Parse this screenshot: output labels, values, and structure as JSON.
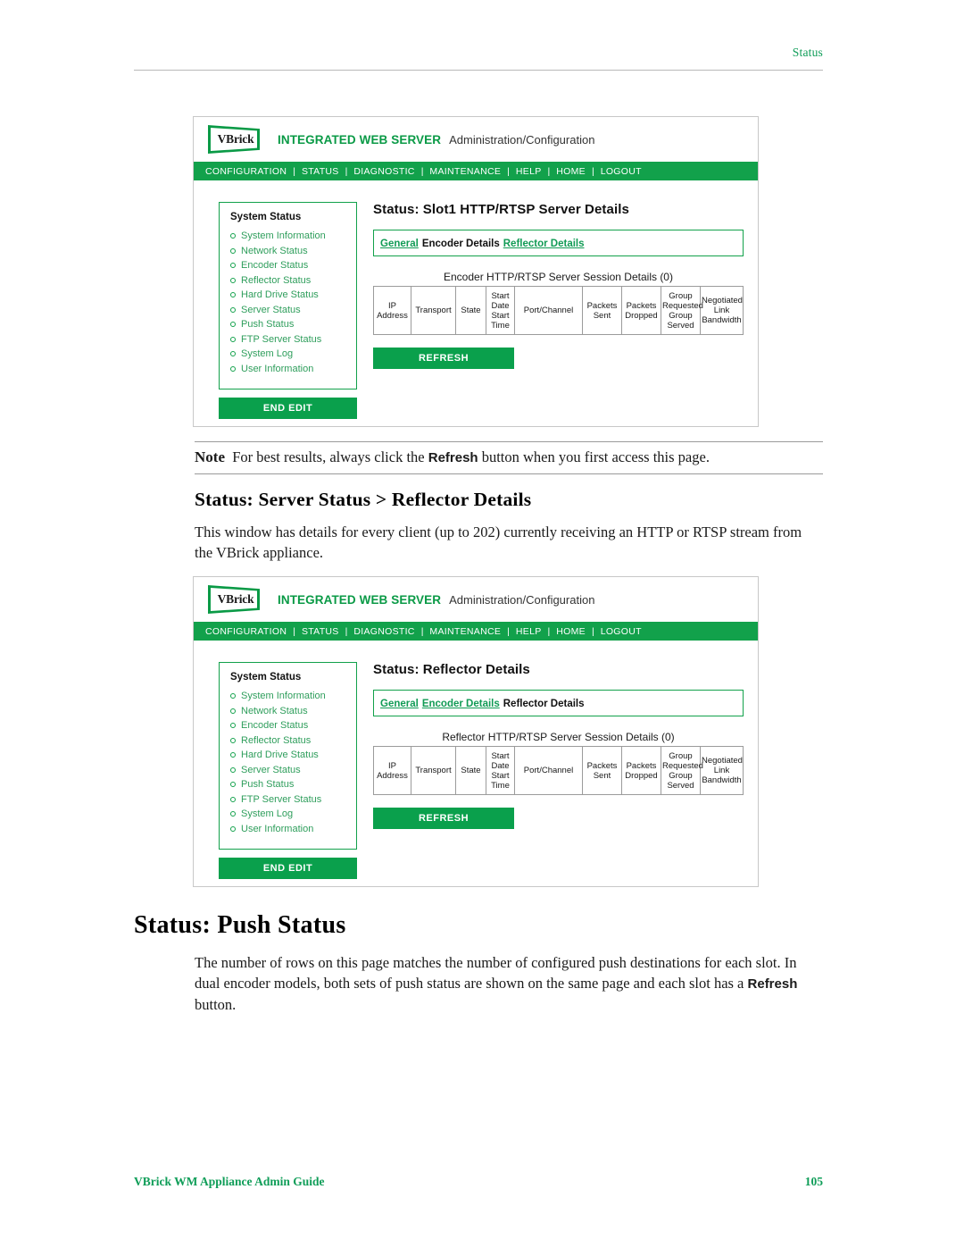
{
  "page": {
    "header_right": "Status",
    "footer_left": "VBrick WM Appliance Admin Guide",
    "footer_page_number": "105"
  },
  "note": {
    "label": "Note",
    "text_before": "For best results, always click the",
    "bold_word": "Refresh",
    "text_after": "button when you first access this page."
  },
  "headings": {
    "reflector_details": "Status: Server Status > Reflector Details",
    "push_status": "Status: Push Status"
  },
  "paragraphs": {
    "reflector_details": "This window has details for every client (up to 202) currently receiving an HTTP or RTSP stream from the VBrick appliance.",
    "push_status_a": "The number of rows on this page matches the number of configured push destinations for each slot. In dual encoder models, both sets of push status are shown on the same page and each slot has a",
    "push_status_bold": "Refresh",
    "push_status_b": "button."
  },
  "screenshots": [
    {
      "logo_text": "VBrick",
      "app_title": "INTEGRATED WEB SERVER",
      "app_subtitle": "Administration/Configuration",
      "nav_items": [
        "CONFIGURATION",
        "STATUS",
        "DIAGNOSTIC",
        "MAINTENANCE",
        "HELP",
        "HOME",
        "LOGOUT"
      ],
      "sidebar": {
        "title": "System Status",
        "items": [
          "System Information",
          "Network Status",
          "Encoder Status",
          "Reflector Status",
          "Hard Drive Status",
          "Server Status",
          "Push Status",
          "FTP Server Status",
          "System Log",
          "User Information"
        ],
        "end_edit_label": "END EDIT"
      },
      "page_title": "Status: Slot1 HTTP/RTSP Server Details",
      "tabs": [
        {
          "label": "General",
          "state": "link"
        },
        {
          "label": "Encoder Details",
          "state": "current"
        },
        {
          "label": "Reflector Details",
          "state": "link"
        }
      ],
      "table_caption": "Encoder HTTP/RTSP Server Session Details  (0)",
      "table_columns": [
        "IP Address",
        "Transport",
        "State",
        "Start Date Start Time",
        "Port/Channel",
        "Packets Sent",
        "Packets Dropped",
        "Group Requested Group Served",
        "Negotiated Link Bandwidth"
      ],
      "refresh_label": "REFRESH"
    },
    {
      "logo_text": "VBrick",
      "app_title": "INTEGRATED WEB SERVER",
      "app_subtitle": "Administration/Configuration",
      "nav_items": [
        "CONFIGURATION",
        "STATUS",
        "DIAGNOSTIC",
        "MAINTENANCE",
        "HELP",
        "HOME",
        "LOGOUT"
      ],
      "sidebar": {
        "title": "System Status",
        "items": [
          "System Information",
          "Network Status",
          "Encoder Status",
          "Reflector Status",
          "Hard Drive Status",
          "Server Status",
          "Push Status",
          "FTP Server Status",
          "System Log",
          "User Information"
        ],
        "end_edit_label": "END EDIT"
      },
      "page_title": "Status: Reflector Details",
      "tabs": [
        {
          "label": "General",
          "state": "link"
        },
        {
          "label": "Encoder Details",
          "state": "link"
        },
        {
          "label": "Reflector Details",
          "state": "current"
        }
      ],
      "table_caption": "Reflector HTTP/RTSP Server Session Details  (0)",
      "table_columns": [
        "IP Address",
        "Transport",
        "State",
        "Start Date Start Time",
        "Port/Channel",
        "Packets Sent",
        "Packets Dropped",
        "Group Requested Group Served",
        "Negotiated Link Bandwidth"
      ],
      "refresh_label": "REFRESH"
    }
  ],
  "colors": {
    "brand_green": "#12a14b",
    "link_green": "#2f9e5c",
    "footer_green": "#0f9d58"
  }
}
